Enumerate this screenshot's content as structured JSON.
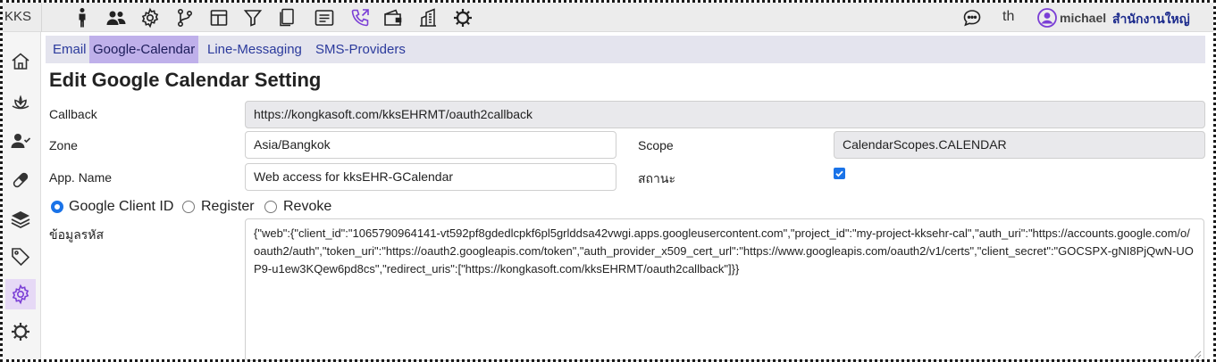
{
  "app": {
    "brand": "KKS"
  },
  "header": {
    "icons": [
      "person-icon",
      "people-icon",
      "gear-icon",
      "branch-icon",
      "layout-icon",
      "filter-icon",
      "documents-icon",
      "message-icon",
      "phone-outgoing-icon",
      "wallet-icon",
      "building-icon",
      "sun-gear-icon"
    ],
    "active_icon": "phone-outgoing-icon",
    "chat_icon": "chat-bubble-icon",
    "language": "th",
    "user_name": "michael",
    "office_name": "สำนักงานใหญ่"
  },
  "sidebar": {
    "items": [
      "home-icon",
      "lotus-icon",
      "user-check-icon",
      "pill-icon",
      "layers-icon",
      "tag-icon",
      "settings-icon",
      "gear-outline-icon"
    ],
    "active_item": "settings-icon"
  },
  "tabs": [
    {
      "label": "Email",
      "active": false
    },
    {
      "label": "Google-Calendar",
      "active": true
    },
    {
      "label": "Line-Messaging",
      "active": false
    },
    {
      "label": "SMS-Providers",
      "active": false
    }
  ],
  "page": {
    "title": "Edit Google Calendar Setting"
  },
  "form": {
    "callback_label": "Callback",
    "callback_value": "https://kongkasoft.com/kksEHRMT/oauth2callback",
    "zone_label": "Zone",
    "zone_value": "Asia/Bangkok",
    "scope_label": "Scope",
    "scope_value": "CalendarScopes.CALENDAR",
    "app_name_label": "App. Name",
    "app_name_value": "Web access for kksEHR-GCalendar",
    "status_label": "สถานะ",
    "status_checked": true,
    "radio_options": [
      {
        "label": "Google Client ID",
        "checked": true
      },
      {
        "label": "Register",
        "checked": false
      },
      {
        "label": "Revoke",
        "checked": false
      }
    ],
    "secret_label": "ข้อมูลรหัส",
    "secret_value": "{\"web\":{\"client_id\":\"1065790964141-vt592pf8gdedlcpkf6pl5grlddsa42vwgi.apps.googleusercontent.com\",\"project_id\":\"my-project-kksehr-cal\",\"auth_uri\":\"https://accounts.google.com/o/oauth2/auth\",\"token_uri\":\"https://oauth2.googleapis.com/token\",\"auth_provider_x509_cert_url\":\"https://www.googleapis.com/oauth2/v1/certs\",\"client_secret\":\"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cs\",\"redirect_uris\":[\"https://kongkasoft.com/kksEHRMT/oauth2callback\"]}}"
  },
  "colors": {
    "accent_purple": "#7b3fd6",
    "tab_active_bg": "#bfb0ea",
    "link_blue": "#2b3a9c",
    "checkbox_blue": "#1a73e8"
  }
}
